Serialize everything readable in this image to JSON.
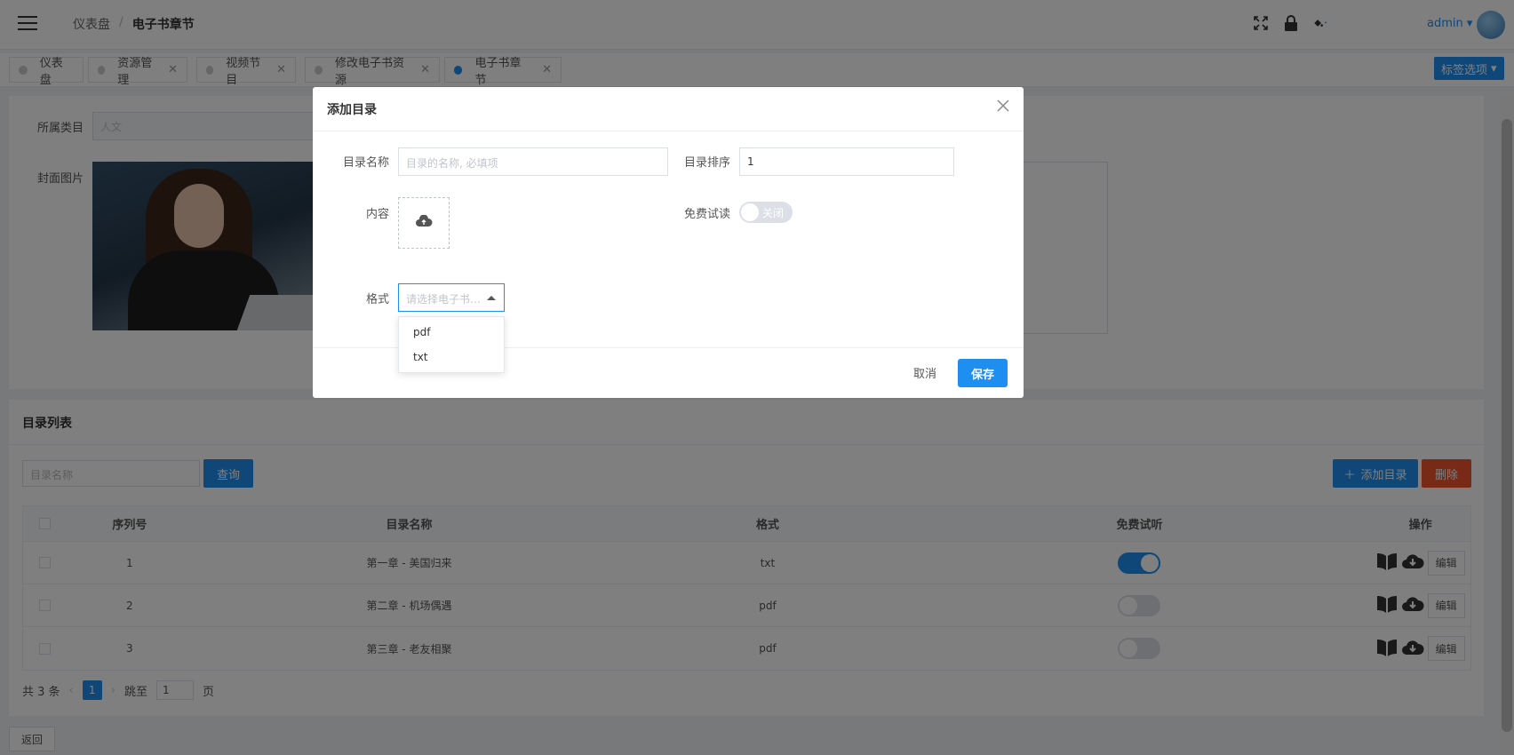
{
  "header": {
    "breadcrumb": [
      "仪表盘",
      "电子书章节"
    ],
    "user": "admin",
    "icons": [
      "fullscreen-icon",
      "lock-icon",
      "paint-bucket-icon"
    ]
  },
  "tabs": [
    {
      "label": "仪表盘",
      "closable": false,
      "active": false
    },
    {
      "label": "资源管理",
      "closable": true,
      "active": false
    },
    {
      "label": "视频节目",
      "closable": true,
      "active": false
    },
    {
      "label": "修改电子书资源",
      "closable": true,
      "active": false
    },
    {
      "label": "电子书章节",
      "closable": true,
      "active": true
    }
  ],
  "tab_options_label": "标签选项",
  "form": {
    "category_label": "所属类目",
    "category_value": "人文",
    "cover_label": "封面图片"
  },
  "list": {
    "title": "目录列表",
    "search_placeholder": "目录名称",
    "query_label": "查询",
    "add_label": "添加目录",
    "delete_label": "删除",
    "columns": [
      "序列号",
      "目录名称",
      "格式",
      "免费试听",
      "操作"
    ],
    "rows": [
      {
        "idx": "1",
        "name": "第一章 - 美国归来",
        "format": "txt",
        "free": true
      },
      {
        "idx": "2",
        "name": "第二章 - 机场偶遇",
        "format": "pdf",
        "free": false
      },
      {
        "idx": "3",
        "name": "第三章 - 老友相聚",
        "format": "pdf",
        "free": false
      }
    ],
    "edit_label": "编辑"
  },
  "pager": {
    "total": "共 3 条",
    "current": "1",
    "jump_label": "跳至",
    "jump_value": "1",
    "page_label": "页"
  },
  "back_label": "返回",
  "modal": {
    "title": "添加目录",
    "name_label": "目录名称",
    "name_placeholder": "目录的名称, 必填项",
    "order_label": "目录排序",
    "order_value": "1",
    "content_label": "内容",
    "free_label": "免费试读",
    "free_switch_text": "关闭",
    "format_label": "格式",
    "format_placeholder": "请选择电子书…",
    "format_options": [
      "pdf",
      "txt"
    ],
    "cancel_label": "取消",
    "save_label": "保存"
  },
  "colors": {
    "primary": "#1e8ff0",
    "danger": "#f0552e"
  }
}
